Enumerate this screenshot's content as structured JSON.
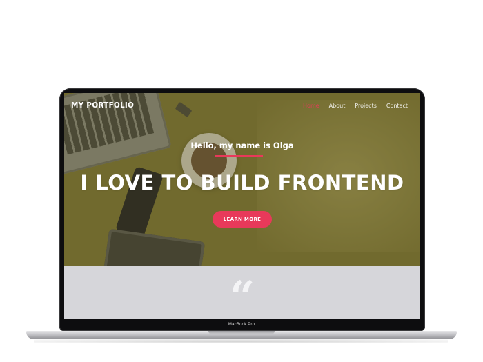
{
  "device": {
    "model_label": "MacBook Pro"
  },
  "site": {
    "logo": "MY PORTFOLIO",
    "nav": [
      {
        "label": "Home",
        "active": true
      },
      {
        "label": "About",
        "active": false
      },
      {
        "label": "Projects",
        "active": false
      },
      {
        "label": "Contact",
        "active": false
      }
    ]
  },
  "hero": {
    "greeting": "Hello, my name is Olga",
    "headline": "I LOVE TO BUILD FRONTEND",
    "cta_label": "LEARN MORE"
  },
  "testimonials": {
    "quote_glyph": "“",
    "quote_icon": "quote-icon"
  },
  "colors": {
    "accent": "#e8395a",
    "hero_bg": "#7f7735",
    "section_bg": "#d6d6da",
    "text_light": "#ffffff"
  }
}
